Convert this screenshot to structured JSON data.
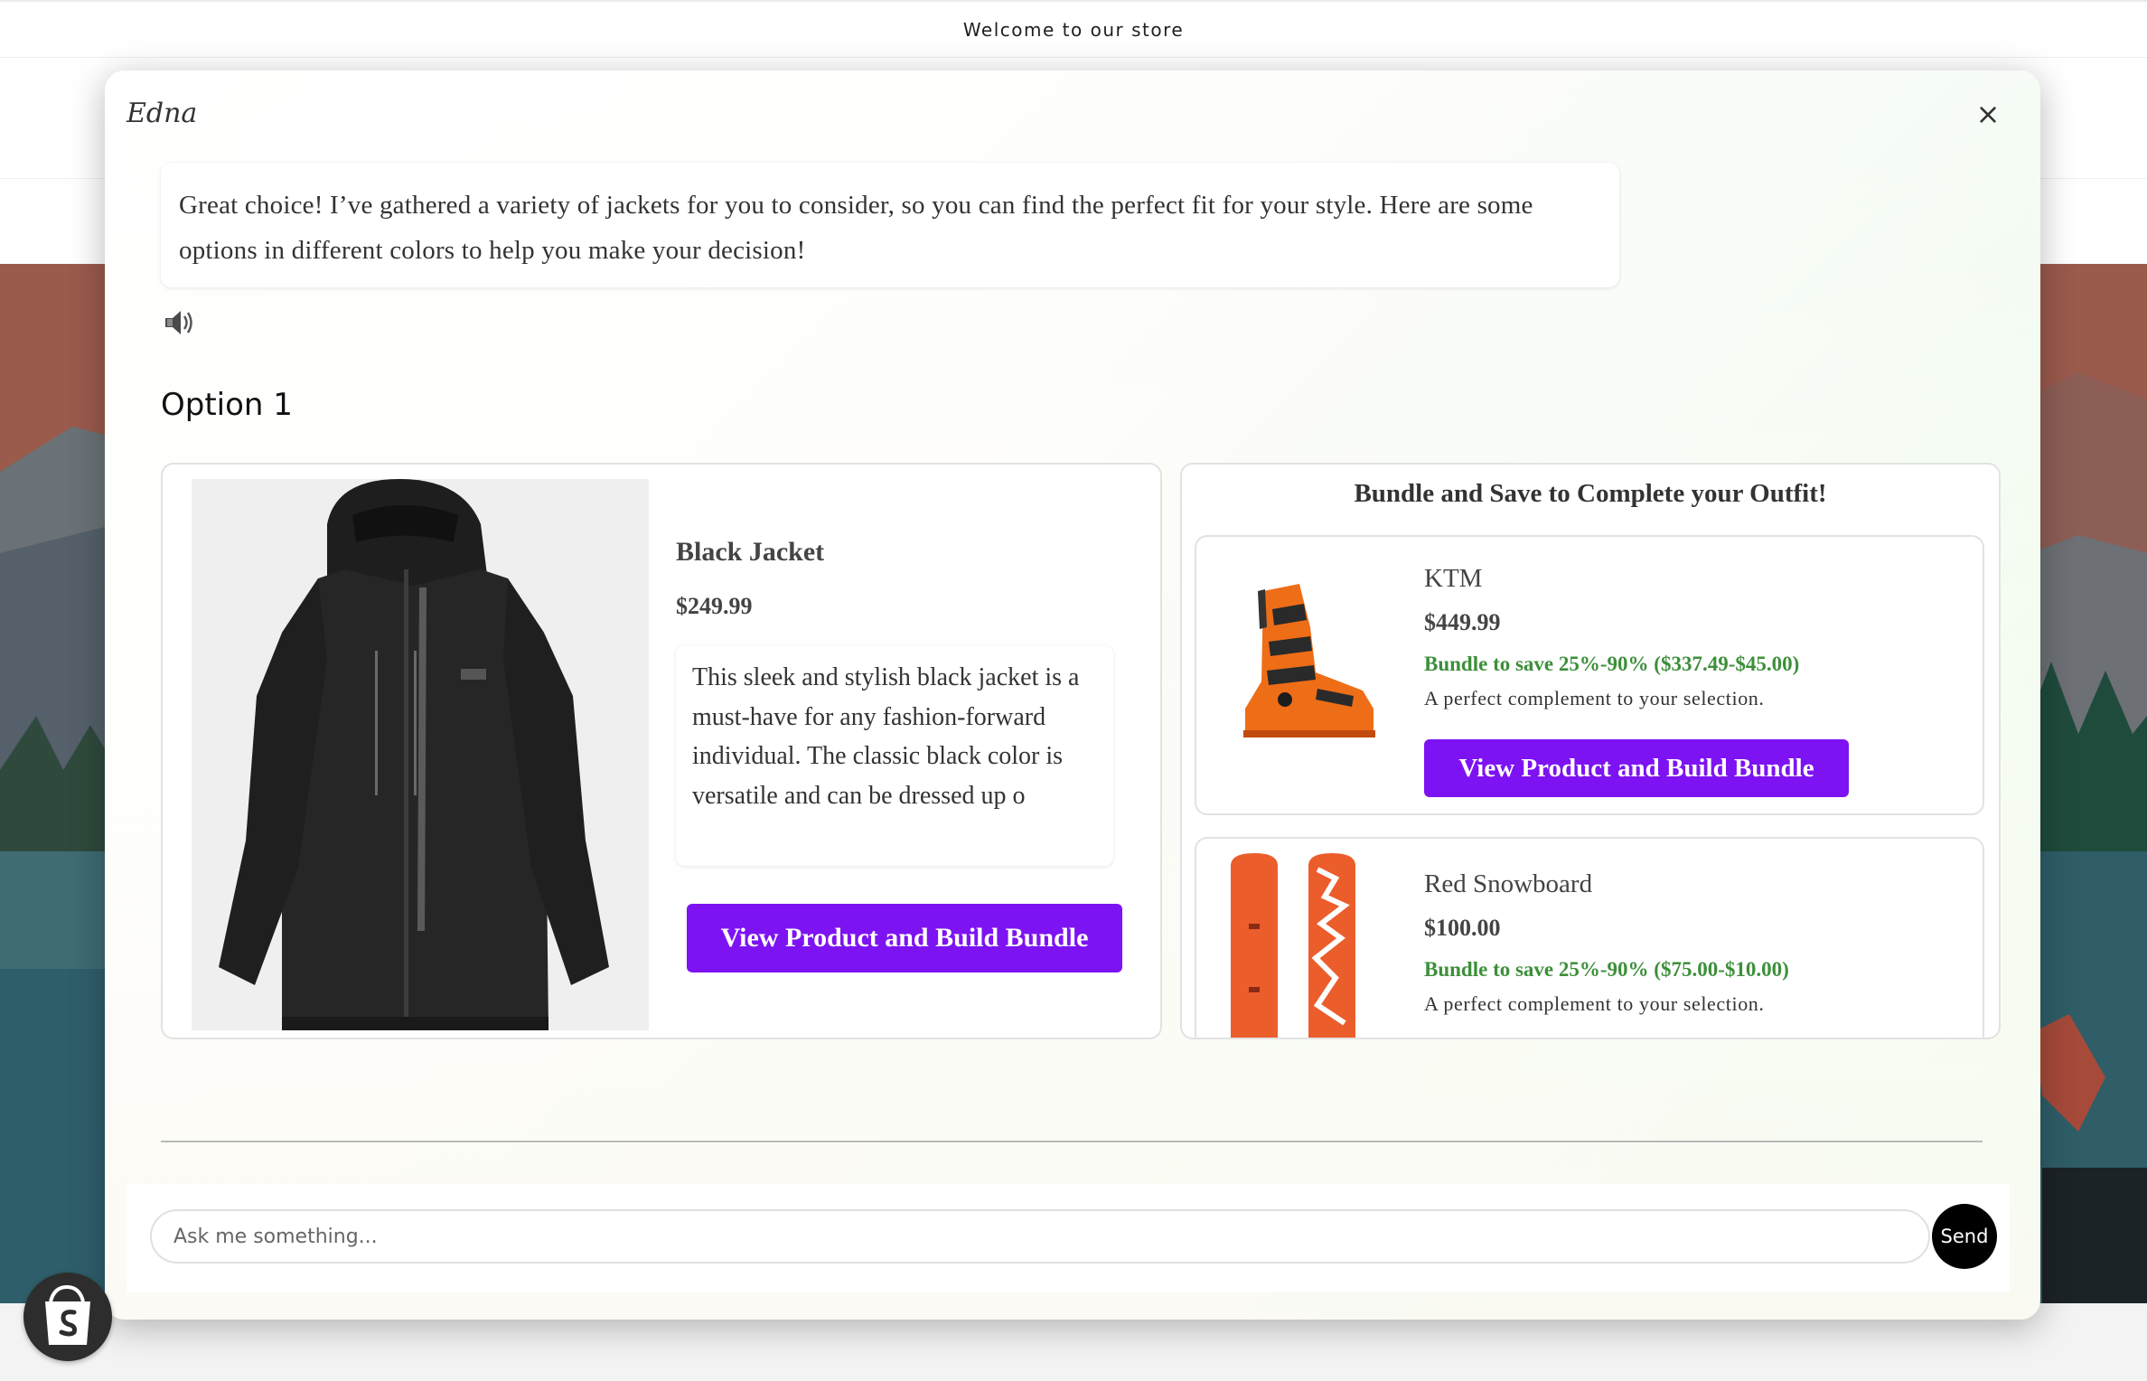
{
  "store": {
    "announcement": "Welcome to our store"
  },
  "chat": {
    "agent_name": "Edna",
    "close_icon": "×",
    "message": "Great choice! I’ve gathered a variety of jackets for you to consider, so you can find the perfect fit for your style. Here are some options in different colors to help you make your decision!",
    "speaker_icon": "speaker-icon",
    "option_title": "Option 1",
    "product": {
      "name": "Black Jacket",
      "price": "$249.99",
      "description": "This sleek and stylish black jacket is a must-have for any fashion-forward individual. The classic black color is versatile and can be dressed up o",
      "button_label": "View Product and Build Bundle"
    },
    "bundle": {
      "title": "Bundle and Save to Complete your Outfit!",
      "items": [
        {
          "name": "KTM",
          "price": "$449.99",
          "savings": "Bundle to save 25%-90% ($337.49-$45.00)",
          "note": "A perfect complement to your selection.",
          "button_label": "View Product and Build Bundle"
        },
        {
          "name": "Red Snowboard",
          "price": "$100.00",
          "savings": "Bundle to save 25%-90% ($75.00-$10.00)",
          "note": "A perfect complement to your selection."
        }
      ]
    },
    "input": {
      "placeholder": "Ask me something...",
      "value": ""
    },
    "send_label": "Send"
  },
  "colors": {
    "accent_purple": "#7d13f2",
    "savings_green": "#3d8f3a",
    "send_black": "#000000"
  }
}
